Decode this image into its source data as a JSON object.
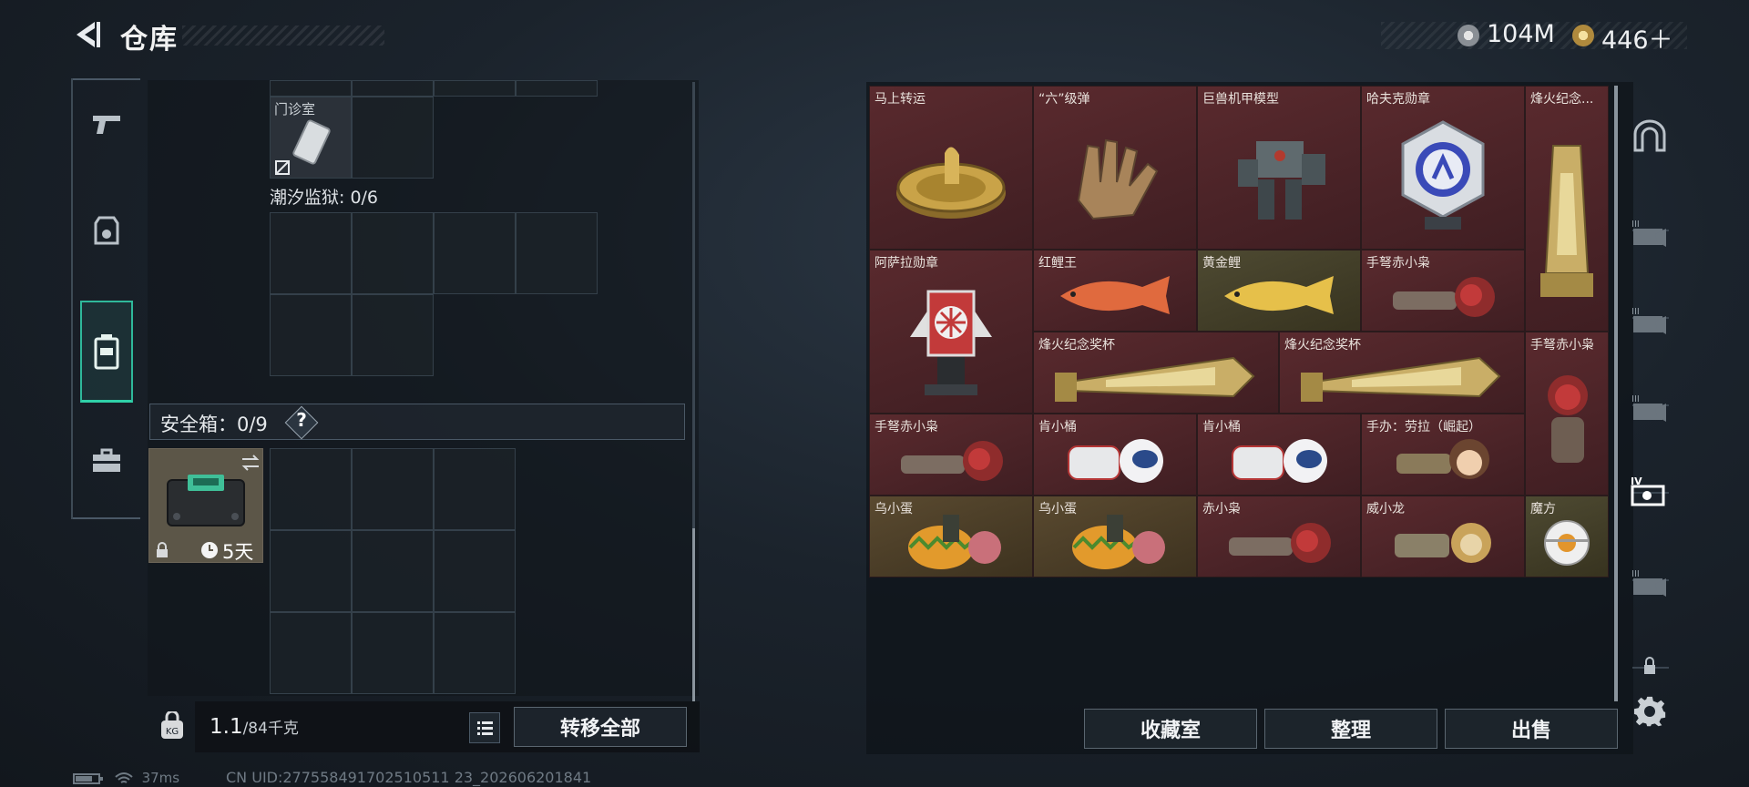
{
  "header": {
    "title": "仓库"
  },
  "currency": [
    {
      "value": "104M"
    },
    {
      "value": "446＋"
    }
  ],
  "left": {
    "clinic_label": "门诊室",
    "tide_prison": "潮汐监狱: 0/6",
    "safe_box": "安全箱：0/9",
    "help": "?",
    "safe_days": "5天",
    "weight_value": "1.1",
    "weight_max": "/84千克",
    "transfer_all": "转移全部"
  },
  "items": [
    {
      "name": "马上转运",
      "tone": "red"
    },
    {
      "name": "“六”级弹",
      "tone": "red"
    },
    {
      "name": "巨兽机甲模型",
      "tone": "red"
    },
    {
      "name": "哈夫克勋章",
      "tone": "red"
    },
    {
      "name": "烽火纪念...",
      "tone": "red"
    },
    {
      "name": "阿萨拉勋章",
      "tone": "red"
    },
    {
      "name": "红鲤王",
      "tone": "red"
    },
    {
      "name": "黄金鲤",
      "tone": "olive"
    },
    {
      "name": "手弩赤小枭",
      "tone": "red"
    },
    {
      "name": "烽火纪念奖杯",
      "tone": "red"
    },
    {
      "name": "烽火纪念奖杯",
      "tone": "red"
    },
    {
      "name": "手弩赤小枭",
      "tone": "red"
    },
    {
      "name": "手弩赤小枭",
      "tone": "red"
    },
    {
      "name": "肯小桶",
      "tone": "red"
    },
    {
      "name": "肯小桶",
      "tone": "red"
    },
    {
      "name": "手办：劳拉（崛起）",
      "tone": "red"
    },
    {
      "name": "乌小蛋",
      "tone": "gold"
    },
    {
      "name": "乌小蛋",
      "tone": "gold"
    },
    {
      "name": "赤小枭",
      "tone": "red"
    },
    {
      "name": "威小龙",
      "tone": "red"
    },
    {
      "name": "魔方",
      "tone": "olive"
    }
  ],
  "bottom_buttons": {
    "collection": "收藏室",
    "organize": "整理",
    "sell": "出售"
  },
  "status": {
    "ping": "37ms",
    "uid": "CN UID:277558491702510511 23_202606201841"
  }
}
